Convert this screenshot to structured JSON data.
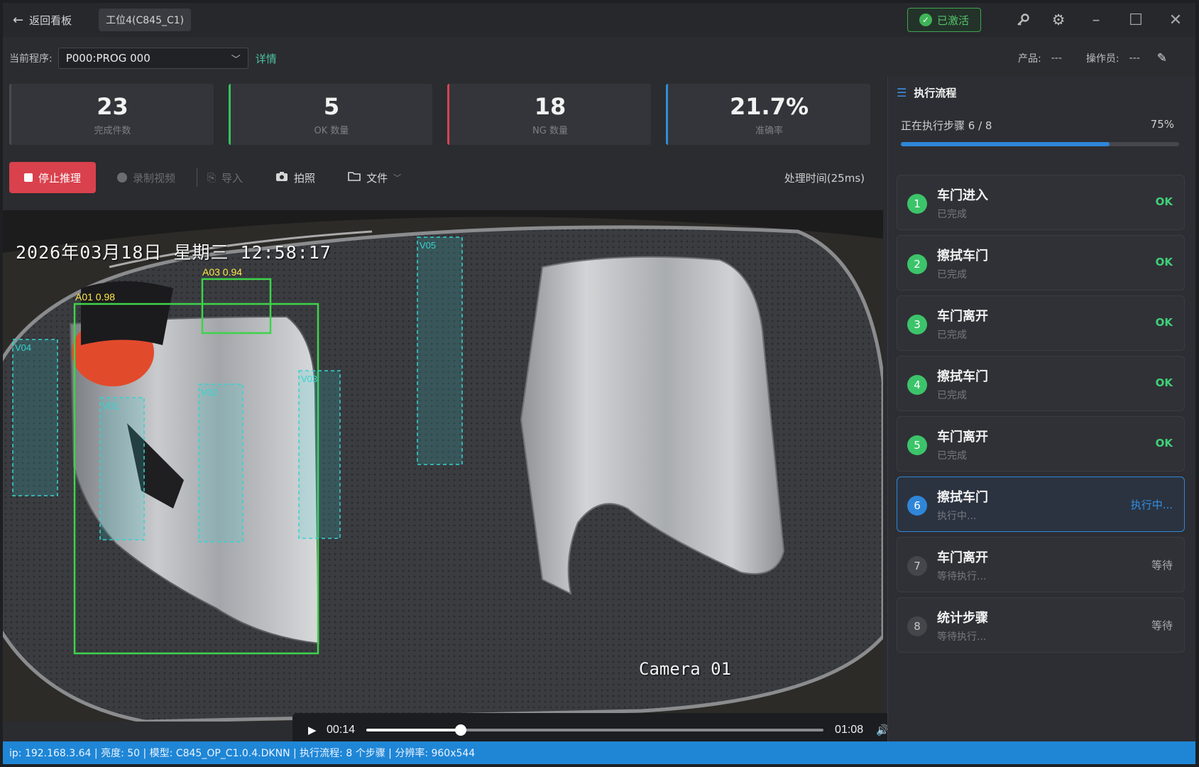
{
  "titlebar": {
    "back_label": "返回看板",
    "station": "工位4(C845_C1)",
    "activated_label": "已激活"
  },
  "program": {
    "label": "当前程序:",
    "selected": "P000:PROG 000",
    "detail_link": "详情",
    "product_label": "产品:",
    "product_value": "---",
    "operator_label": "操作员:",
    "operator_value": "---"
  },
  "stats": [
    {
      "value": "23",
      "label": "完成件数"
    },
    {
      "value": "5",
      "label": "OK 数量"
    },
    {
      "value": "18",
      "label": "NG 数量"
    },
    {
      "value": "21.7%",
      "label": "准确率"
    }
  ],
  "toolbar": {
    "stop_label": "停止推理",
    "record_label": "录制视频",
    "import_label": "导入",
    "capture_label": "拍照",
    "file_label": "文件",
    "process_time": "处理时间(25ms)"
  },
  "video": {
    "osd_date": "2026年03月18日  星期三  12:58:17",
    "osd_camera": "Camera 01",
    "detections": {
      "a01": "A01 0.98",
      "a03": "A03 0.94",
      "v01": "V01",
      "v02": "V02",
      "v03": "V03",
      "v04": "V04",
      "v05": "V05"
    }
  },
  "player": {
    "current_time": "00:14",
    "total_time": "01:08",
    "progress": 0.206
  },
  "statusbar": {
    "text": "ip: 192.168.3.64 | 亮度: 50 | 模型: C845_OP_C1.0.4.DKNN | 执行流程: 8 个步骤 | 分辨率: 960x544"
  },
  "panel": {
    "title": "执行流程",
    "progress_text": "正在执行步骤 6 / 8",
    "progress_pct": "75%",
    "progress_value": 0.75,
    "steps": [
      {
        "num": "1",
        "title": "车门进入",
        "sub": "已完成",
        "badge": "OK",
        "state": "done"
      },
      {
        "num": "2",
        "title": "擦拭车门",
        "sub": "已完成",
        "badge": "OK",
        "state": "done"
      },
      {
        "num": "3",
        "title": "车门离开",
        "sub": "已完成",
        "badge": "OK",
        "state": "done"
      },
      {
        "num": "4",
        "title": "擦拭车门",
        "sub": "已完成",
        "badge": "OK",
        "state": "done"
      },
      {
        "num": "5",
        "title": "车门离开",
        "sub": "已完成",
        "badge": "OK",
        "state": "done"
      },
      {
        "num": "6",
        "title": "擦拭车门",
        "sub": "执行中...",
        "badge": "执行中...",
        "state": "run"
      },
      {
        "num": "7",
        "title": "车门离开",
        "sub": "等待执行...",
        "badge": "等待",
        "state": "wait"
      },
      {
        "num": "8",
        "title": "统计步骤",
        "sub": "等待执行...",
        "badge": "等待",
        "state": "wait"
      }
    ]
  },
  "colors": {
    "accent": "#2f86d8",
    "ok": "#3fd17a",
    "ng": "#d94450",
    "stop_button": "#d9414d",
    "detection_box": "#3ed34a",
    "zone_box": "#35d3d0"
  }
}
